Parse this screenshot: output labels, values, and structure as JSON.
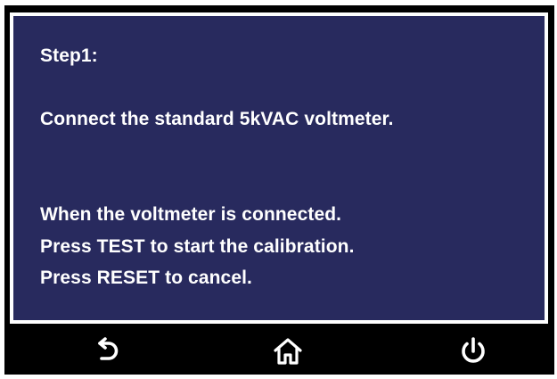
{
  "dialog": {
    "step": "Step1:",
    "instruction": "Connect the standard 5kVAC voltmeter.",
    "when_connected": "When the voltmeter is connected.",
    "press_test": "Press TEST to start the calibration.",
    "press_reset": "Press RESET to cancel."
  },
  "nav": {
    "buttons": [
      {
        "icon": "back-arrow-icon"
      },
      {
        "icon": "home-icon"
      },
      {
        "icon": "power-icon"
      }
    ]
  },
  "colors": {
    "panel_background": "#282a5e",
    "panel_border": "#ffffff",
    "frame": "#000000",
    "text": "#ffffff"
  }
}
